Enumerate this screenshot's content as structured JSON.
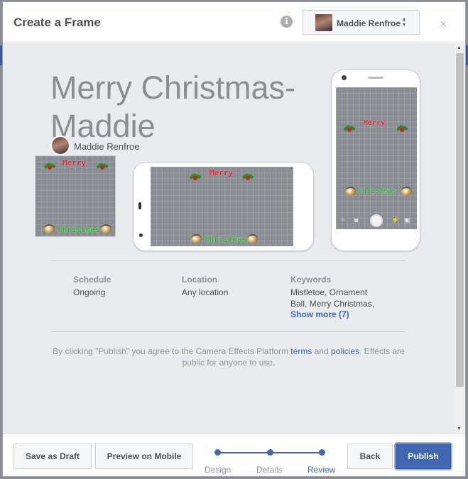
{
  "dialog": {
    "title": "Create a Frame",
    "close_label": "×"
  },
  "account": {
    "name": "Maddie Renfroe",
    "caret": "▲▼"
  },
  "effect": {
    "title": "Merry Christmas- Maddie",
    "author": "Maddie Renfroe"
  },
  "frame_art": {
    "top_text": "Merry",
    "bottom_text": "Christmas"
  },
  "details": {
    "schedule": {
      "label": "Schedule",
      "value": "Ongoing"
    },
    "location": {
      "label": "Location",
      "value": "Any location"
    },
    "keywords": {
      "label": "Keywords",
      "value_line1": "Mistletoe, Ornament",
      "value_line2": "Ball, Merry Christmas,",
      "more": "Show more (7)"
    }
  },
  "legal": {
    "pre": "By clicking \"Publish\" you agree to the Camera Effects Platform ",
    "terms": "terms",
    "and": " and ",
    "policies": "policies",
    "post": ". Effects are public for anyone to use."
  },
  "footer": {
    "save_draft": "Save as Draft",
    "preview_mobile": "Preview on Mobile",
    "back": "Back",
    "publish": "Publish",
    "steps": [
      {
        "label": "Design",
        "active": false
      },
      {
        "label": "Details",
        "active": false
      },
      {
        "label": "Review",
        "active": true
      }
    ]
  },
  "colors": {
    "accent": "#4267b2",
    "merry": "#e0232c",
    "christmas": "#2db52d",
    "frame_bg": "#8a8d94"
  },
  "icons": [
    "info-icon",
    "close-icon",
    "sort-caret-icon",
    "shutter-icon",
    "flash-icon",
    "gallery-icon",
    "effects-icon"
  ]
}
